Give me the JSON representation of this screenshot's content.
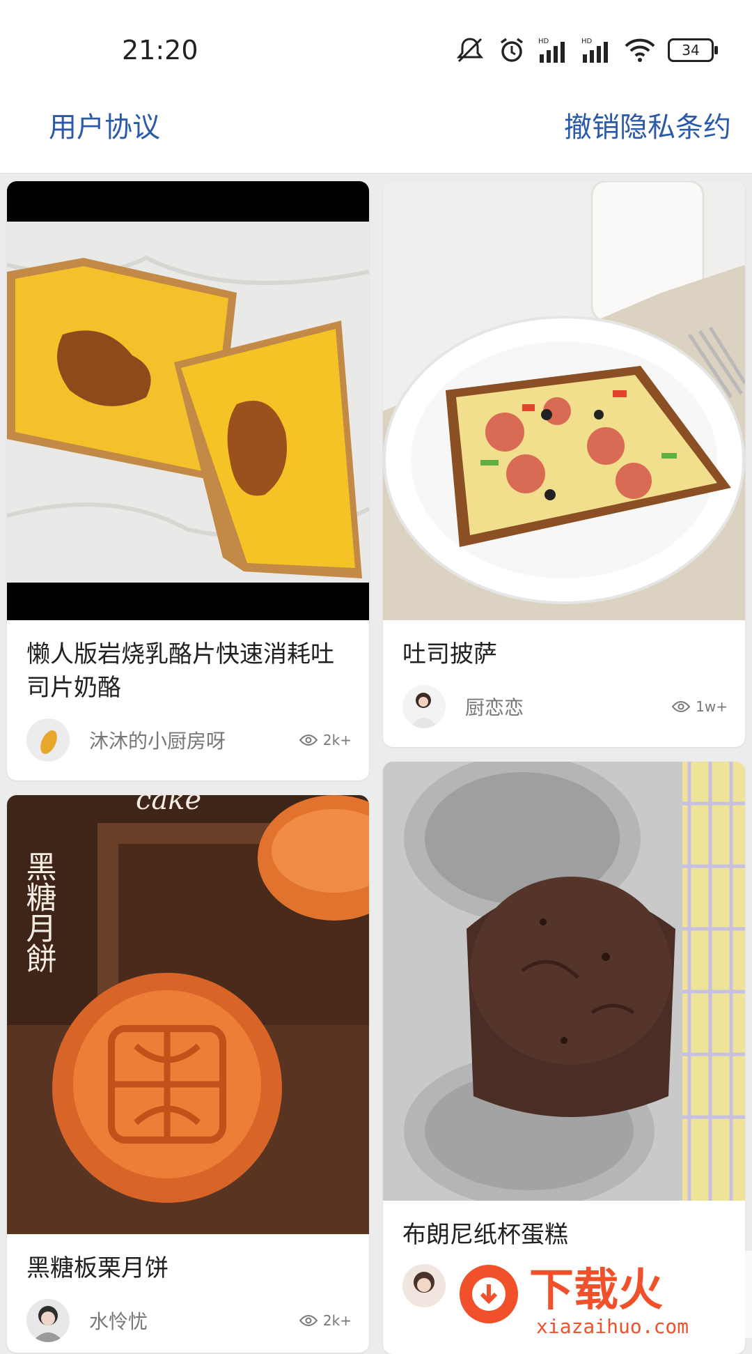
{
  "status_bar": {
    "time": "21:20",
    "icons": [
      "mute-icon",
      "alarm-icon",
      "hd-signal-icon",
      "hd-signal-icon",
      "wifi-icon",
      "battery-icon"
    ],
    "battery": "34",
    "signal_badge": "HD"
  },
  "header": {
    "left_link": "用户协议",
    "right_link": "撤销隐私条约",
    "link_color": "#2b5aa8"
  },
  "feed": [
    {
      "title": "懒人版岩烧乳酪片快速消耗吐司片奶酪",
      "author": "沐沐的小厨房呀",
      "views": "2k+"
    },
    {
      "title": "吐司披萨",
      "author": "厨恋恋",
      "views": "1w+"
    },
    {
      "title": "黑糖板栗月饼",
      "author": "水怜忧",
      "views": "2k+",
      "image_text": "黑糖月餅",
      "image_text_partial": "cake"
    },
    {
      "title": "布朗尼纸杯蛋糕",
      "author": "",
      "views": ""
    }
  ],
  "watermark": {
    "brand": "下载火",
    "url": "xiazaihuo.com"
  }
}
